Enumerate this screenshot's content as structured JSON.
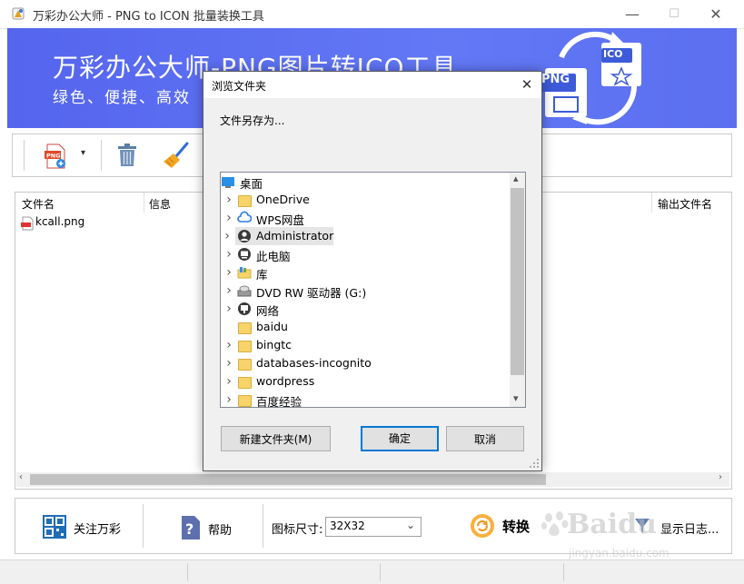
{
  "window": {
    "title": "万彩办公大师 - PNG to ICON 批量装换工具",
    "minimize_glyph": "—",
    "maximize_glyph": "☐",
    "close_glyph": "✕"
  },
  "banner": {
    "title": "万彩办公大师-PNG图片转ICO工具",
    "subtitle": "绿色、便捷、高效",
    "png_badge": "PNG",
    "ico_badge": "ICO"
  },
  "toolbar": {
    "add_png_icon": "png-add-icon",
    "dropdown_glyph": "▾",
    "delete_icon": "trash-icon",
    "clear_icon": "broom-icon"
  },
  "file_list": {
    "columns": [
      "文件名",
      "信息",
      "输出文件名"
    ],
    "rows": [
      {
        "name": "kcall.png"
      }
    ]
  },
  "bottom": {
    "follow_label": "关注万彩",
    "help_label": "帮助",
    "size_label": "图标尺寸:",
    "size_value": "32X32",
    "convert_label": "转换",
    "log_label": "显示日志..."
  },
  "dialog": {
    "title": "浏览文件夹",
    "close_glyph": "✕",
    "prompt": "文件另存为...",
    "tree": [
      {
        "label": "桌面",
        "icon": "desktop-icon",
        "expand": false,
        "level": 0
      },
      {
        "label": "OneDrive",
        "icon": "folder-icon",
        "expand": true,
        "level": 1
      },
      {
        "label": "WPS网盘",
        "icon": "cloud-icon",
        "expand": true,
        "level": 1
      },
      {
        "label": "Administrator",
        "icon": "user-icon",
        "expand": true,
        "level": 1,
        "selected": true
      },
      {
        "label": "此电脑",
        "icon": "computer-icon",
        "expand": true,
        "level": 1
      },
      {
        "label": "库",
        "icon": "library-icon",
        "expand": true,
        "level": 1
      },
      {
        "label": "DVD RW 驱动器 (G:)",
        "icon": "dvd-drive-icon",
        "expand": true,
        "level": 1
      },
      {
        "label": "网络",
        "icon": "network-icon",
        "expand": true,
        "level": 1
      },
      {
        "label": "baidu",
        "icon": "folder-icon",
        "expand": false,
        "level": 1
      },
      {
        "label": "bingtc",
        "icon": "folder-icon",
        "expand": true,
        "level": 1
      },
      {
        "label": "databases-incognito",
        "icon": "folder-icon",
        "expand": true,
        "level": 1
      },
      {
        "label": "wordpress",
        "icon": "folder-icon",
        "expand": true,
        "level": 1
      },
      {
        "label": "百度经验",
        "icon": "folder-icon",
        "expand": true,
        "level": 1
      }
    ],
    "new_folder_label": "新建文件夹(M)",
    "ok_label": "确定",
    "cancel_label": "取消",
    "scroll_up_glyph": "▴",
    "scroll_down_glyph": "▾"
  },
  "watermark": {
    "brand": "Baidu",
    "sub": "jingyan.baidu.com"
  },
  "colors": {
    "banner": "#5b6ff0",
    "accent": "#0078d7",
    "convert": "#f29b1e"
  }
}
